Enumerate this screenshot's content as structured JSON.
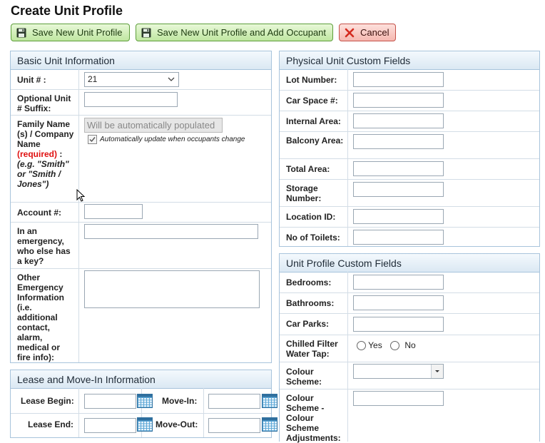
{
  "title": "Create Unit Profile",
  "buttons": {
    "save": "Save New Unit Profile",
    "save_add": "Save New Unit Profile and Add Occupant",
    "cancel": "Cancel"
  },
  "basic": {
    "title": "Basic Unit Information",
    "unit_label": "Unit # :",
    "unit_value": "21",
    "suffix_label": "Optional Unit # Suffix:",
    "family_label": "Family Name (s) / Company Name",
    "required": "(required)",
    "colon": " :",
    "example": "(e.g. \"Smith\" or \"Smith / Jones\")",
    "family_placeholder": "Will be automatically populated",
    "auto_update": "Automatically update when occupants change",
    "account_label": "Account #:",
    "emergency_label": "In an emergency, who else has a key?",
    "other_label": "Other Emergency Information (i.e. additional contact, alarm, medical or fire info):"
  },
  "lease": {
    "title": "Lease and Move-In Information",
    "lease_begin": "Lease Begin:",
    "lease_end": "Lease End:",
    "move_in": "Move-In:",
    "move_out": "Move-Out:"
  },
  "physical": {
    "title": "Physical Unit Custom Fields",
    "fields": [
      "Lot Number:",
      "Car Space #:",
      "Internal Area:",
      "Balcony Area:",
      "Total Area:",
      "Storage Number:",
      "Location ID:",
      "No of Toilets:"
    ]
  },
  "profile": {
    "title": "Unit Profile Custom Fields",
    "bedrooms": "Bedrooms:",
    "bathrooms": "Bathrooms:",
    "car_parks": "Car Parks:",
    "chilled": "Chilled Filter Water Tap:",
    "yes": "Yes",
    "no": "No",
    "colour": "Colour Scheme:",
    "colour_adj": "Colour Scheme - Colour Scheme Adjustments:"
  },
  "colors": {
    "accent": "#5d9e3a",
    "danger": "#c4524a",
    "panel_border": "#a8c4dc",
    "required": "#e01010"
  }
}
